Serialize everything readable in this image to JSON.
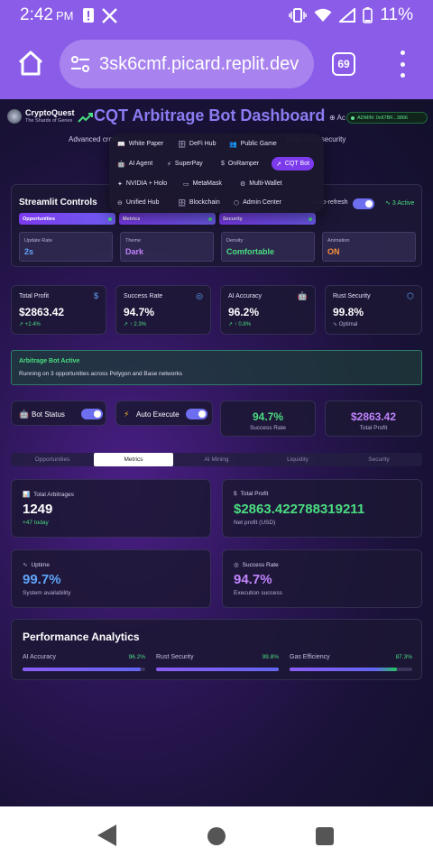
{
  "status": {
    "time": "2:42",
    "ampm": "PM",
    "battery": "11%"
  },
  "browser": {
    "url": "3sk6cmf.picard.replit.dev",
    "tabs": "69"
  },
  "brand": {
    "name": "CryptoQuest",
    "tagline": "The Shards of Genes"
  },
  "header": {
    "title": "CQT Arbitrage Bot Dashboard",
    "admin": "ADMIN: 0x67BF...3866",
    "lang": "Ac",
    "subtitle_left": "Advanced cross-c",
    "subtitle_right": "king, Rust security"
  },
  "menu": {
    "items": [
      {
        "label": "White Paper",
        "icon": "📖"
      },
      {
        "label": "DeFi Hub",
        "icon": "🗄"
      },
      {
        "label": "Public Game",
        "icon": "👥"
      },
      {
        "label": "AI Agent",
        "icon": "🤖"
      },
      {
        "label": "SuperPay",
        "icon": "⚡"
      },
      {
        "label": "OnRamper",
        "icon": "$"
      },
      {
        "label": "CQT Bot",
        "icon": "↗"
      },
      {
        "label": "NVIDIA + Holo",
        "icon": "✦"
      },
      {
        "label": "MetaMask",
        "icon": "▭"
      },
      {
        "label": "Multi-Wallet",
        "icon": "⚙"
      },
      {
        "label": "Unified Hub",
        "icon": "⊖"
      },
      {
        "label": "Blockchain",
        "icon": "🗄"
      },
      {
        "label": "Admin Center",
        "icon": "⬡"
      }
    ]
  },
  "controls": {
    "title": "Streamlit Controls",
    "auto_refresh": "Auto-refresh",
    "active": "3 Active",
    "tags": [
      "Opportunities",
      "Metrics",
      "Security"
    ],
    "settings": [
      {
        "label": "Update Rate",
        "value": "2s",
        "color": "#60a5fa"
      },
      {
        "label": "Theme",
        "value": "Dark",
        "color": "#c084fc"
      },
      {
        "label": "Density",
        "value": "Comfortable",
        "color": "#4ade80"
      },
      {
        "label": "Animation",
        "value": "ON",
        "color": "#fb923c"
      }
    ]
  },
  "stats": [
    {
      "label": "Total Profit",
      "value": "$2863.42",
      "change": "↗ +2.4%",
      "icon": "$",
      "icon_color": "#60a5fa"
    },
    {
      "label": "Success Rate",
      "value": "94.7%",
      "change": "↗ ↑ 2.3%",
      "icon": "◎",
      "icon_color": "#60a5fa"
    },
    {
      "label": "AI Accuracy",
      "value": "96.2%",
      "change": "↗ ↑ 0.8%",
      "icon": "🤖",
      "icon_color": "#60a5fa"
    },
    {
      "label": "Rust Security",
      "value": "99.8%",
      "change": "∿ Optimal",
      "icon": "⬡",
      "icon_color": "#60a5fa"
    }
  ],
  "alert": {
    "title": "Arbitrage Bot Active",
    "text": "Running on 3 opportunities across Polygon and Base networks"
  },
  "bot_status": {
    "label": "Bot Status",
    "icon": "🤖"
  },
  "auto_execute": {
    "label": "Auto Execute",
    "icon": "⚡"
  },
  "mini": [
    {
      "value": "94.7%",
      "label": "Success Rate",
      "color": "#4ade80"
    },
    {
      "value": "$2863.42",
      "label": "Total Profit",
      "color": "#c084fc"
    }
  ],
  "tabs": [
    "Opportunities",
    "Metrics",
    "AI Mining",
    "Liquidity",
    "Security"
  ],
  "metrics": [
    {
      "label": "Total Arbitrages",
      "icon": "📊",
      "value": "1249",
      "sub": "+47 today",
      "value_color": "#ffffff",
      "sub_color": "#4ade80"
    },
    {
      "label": "Total Profit",
      "icon": "$",
      "value": "$2863.422788319211",
      "sub": "Net profit (USD)",
      "value_color": "#4ade80",
      "sub_color": "#b6b0d6"
    },
    {
      "label": "Uptime",
      "icon": "∿",
      "value": "99.7%",
      "sub": "System availability",
      "value_color": "#60a5fa",
      "sub_color": "#b6b0d6"
    },
    {
      "label": "Success Rate",
      "icon": "◎",
      "value": "94.7%",
      "sub": "Execution success",
      "value_color": "#c084fc",
      "sub_color": "#b6b0d6"
    }
  ],
  "performance": {
    "title": "Performance Analytics",
    "bars": [
      {
        "label": "AI Accuracy",
        "pct": "96.2%",
        "value": 0.962
      },
      {
        "label": "Rust Security",
        "pct": "99.8%",
        "value": 0.998
      },
      {
        "label": "Gas Efficiency",
        "pct": "87.3%",
        "value": 0.873
      }
    ]
  }
}
